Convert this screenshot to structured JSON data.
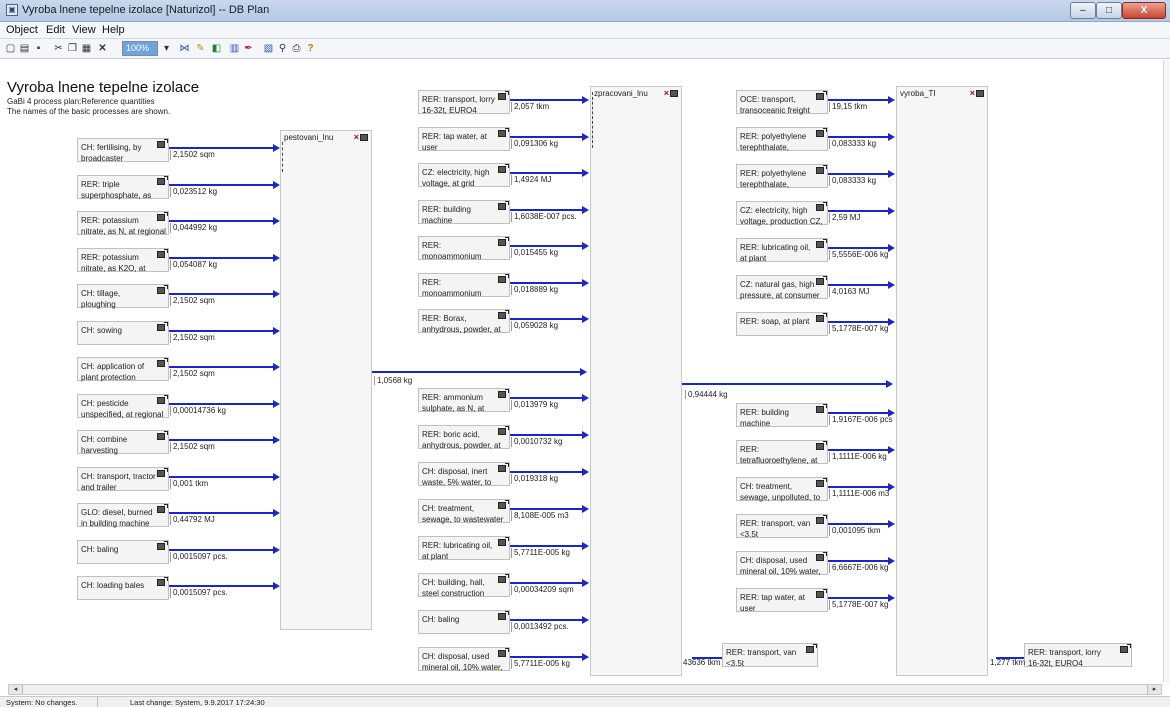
{
  "window": {
    "title": "Vyroba lnene tepelne izolace [Naturizol] -- DB Plan",
    "minimize": "–",
    "maximize": "□",
    "close": "X"
  },
  "menu": [
    "Object",
    "Edit",
    "View",
    "Help"
  ],
  "toolbar": {
    "zoom": "100%"
  },
  "plan": {
    "title": "Vyroba lnene tepelne izolace",
    "subtitle1": "GaBi 4 process plan:Reference quantities",
    "subtitle2": "The names of the basic processes are shown."
  },
  "hubs": {
    "pestovani": "pestovani_lnu",
    "zpracovani": "zpracovani_lnu",
    "vyroba": "vyroba_TI"
  },
  "flows": {
    "pestovani_out": "1,0568 kg",
    "zpracovani_out": "0,94444 kg",
    "van_qty": "43636 tkm",
    "lorry_qty": "1,277 tkm"
  },
  "col1": [
    {
      "label": "CH: fertilising, by\nbroadcaster",
      "qty": "2,1502 sqm"
    },
    {
      "label": "RER: triple\nsuperphosphate, as",
      "qty": "0,023512 kg"
    },
    {
      "label": "RER: potassium\nnitrate, as N, at regional",
      "qty": "0,044992 kg"
    },
    {
      "label": "RER: potassium\nnitrate, as K2O, at",
      "qty": "0,054087 kg"
    },
    {
      "label": "CH: tillage,\nploughing",
      "qty": "2,1502 sqm"
    },
    {
      "label": "CH: sowing",
      "qty": "2,1502 sqm"
    },
    {
      "label": "CH: application of\nplant protection",
      "qty": "2,1502 sqm"
    },
    {
      "label": "CH: pesticide\nunspecified, at regional",
      "qty": "0,00014736 kg"
    },
    {
      "label": "CH: combine\nharvesting",
      "qty": "2,1502 sqm"
    },
    {
      "label": "CH: transport, tractor\nand trailer",
      "qty": "0,001 tkm"
    },
    {
      "label": "GLO: diesel, burned\nin building machine",
      "qty": "0,44792 MJ"
    },
    {
      "label": "CH: baling",
      "qty": "0,0015097 pcs."
    },
    {
      "label": "CH: loading bales",
      "qty": "0,0015097 pcs."
    }
  ],
  "col2top": [
    {
      "label": "RER: transport, lorry\n16-32t, EURO4",
      "qty": "2,057 tkm"
    },
    {
      "label": "RER: tap water, at\nuser",
      "qty": "0,091306 kg"
    },
    {
      "label": "CZ: electricity, high\nvoltage, at grid",
      "qty": "1,4924 MJ"
    },
    {
      "label": "RER: building\nmachine",
      "qty": "1,6038E-007 pcs."
    },
    {
      "label": "RER:\nmonoammonium",
      "qty": "0,015455 kg"
    },
    {
      "label": "RER:\nmonoammonium",
      "qty": "0,018889 kg"
    },
    {
      "label": "RER: Borax,\nanhydrous, powder, at",
      "qty": "0,059028 kg"
    }
  ],
  "col2bot": [
    {
      "label": "RER: ammonium\nsulphate, as N, at",
      "qty": "0,013979 kg"
    },
    {
      "label": "RER: boric acid,\nanhydrous, powder, at",
      "qty": "0,0010732 kg"
    },
    {
      "label": "CH: disposal, inert\nwaste, 5% water, to",
      "qty": "0,019318 kg"
    },
    {
      "label": "CH: treatment,\nsewage, to wastewater",
      "qty": "8,108E-005 m3"
    },
    {
      "label": "RER: lubricating oil,\nat plant",
      "qty": "5,7711E-005 kg"
    },
    {
      "label": "CH: building, hall,\nsteel construction",
      "qty": "0,00034209 sqm"
    },
    {
      "label": "CH: baling",
      "qty": "0,0013492 pcs."
    },
    {
      "label": "CH: disposal, used\nmineral oil, 10% water,",
      "qty": "5,7711E-005 kg"
    }
  ],
  "col3top": [
    {
      "label": "OCE: transport,\ntransoceanic freight",
      "qty": "19,15 tkm"
    },
    {
      "label": "RER: polyethylene\nterephthalate,",
      "qty": "0,083333 kg"
    },
    {
      "label": "RER: polyethylene\nterephthalate,",
      "qty": "0,083333 kg"
    },
    {
      "label": "CZ: electricity, high\nvoltage, production CZ,",
      "qty": "2,59 MJ"
    },
    {
      "label": "RER: lubricating oil,\nat plant",
      "qty": "5,5556E-006 kg"
    },
    {
      "label": "CZ: natural gas, high\npressure, at consumer",
      "qty": "4,0163 MJ"
    },
    {
      "label": "RER: soap, at plant",
      "qty": "5,1778E-007 kg"
    }
  ],
  "col3bot": [
    {
      "label": "RER: building\nmachine",
      "qty": "1,9167E-006 pcs"
    },
    {
      "label": "RER:\ntetrafluoroethylene, at",
      "qty": "1,1111E-006 kg"
    },
    {
      "label": "CH: treatment,\nsewage, unpolluted, to",
      "qty": "1,1111E-006 m3"
    },
    {
      "label": "RER: transport, van\n<3.5t",
      "qty": "0,001095 tkm"
    },
    {
      "label": "CH: disposal, used\nmineral oil, 10% water,",
      "qty": "6,6667E-006 kg"
    },
    {
      "label": "RER: tap water, at\nuser",
      "qty": "5,1778E-007 kg"
    }
  ],
  "extras": {
    "van": "RER: transport, van\n<3.5t",
    "lorry": "RER: transport, lorry\n16-32t, EURO4"
  },
  "status": {
    "left": "System: No changes.",
    "right": "Last change: System, 9.9.2017 17:24:30"
  }
}
